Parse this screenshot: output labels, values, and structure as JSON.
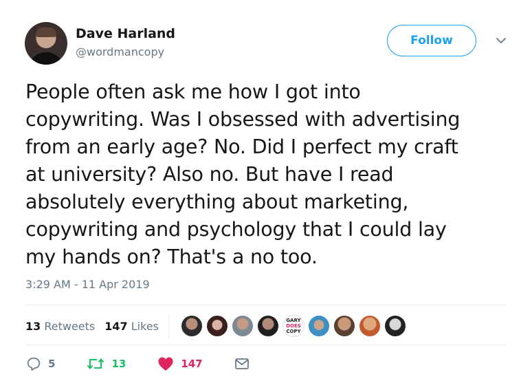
{
  "author": {
    "name": "Dave Harland",
    "handle": "@wordmancopy"
  },
  "follow_label": "Follow",
  "tweet": {
    "lines": [
      "People often ask me how I got into",
      "copywriting. Was I obsessed with advertising",
      "from an early age? No. Did I perfect my craft",
      "at university? Also no. But have I read",
      "absolutely everything about marketing,",
      "copywriting and psychology that I could lay",
      "my hands on? That's a no too."
    ]
  },
  "timestamp": "3:29 AM - 11 Apr 2019",
  "stats": {
    "retweets_count": "13",
    "retweets_label": "Retweets",
    "likes_count": "147",
    "likes_label": "Likes"
  },
  "likers": {
    "logo_text": [
      "GARY",
      "DOES",
      "COPY"
    ]
  },
  "actions": {
    "reply_count": "5",
    "retweet_count": "13",
    "like_count": "147"
  },
  "colors": {
    "accent": "#1da1f2",
    "retweet": "#17bf63",
    "like": "#e0245e",
    "muted": "#657786"
  }
}
